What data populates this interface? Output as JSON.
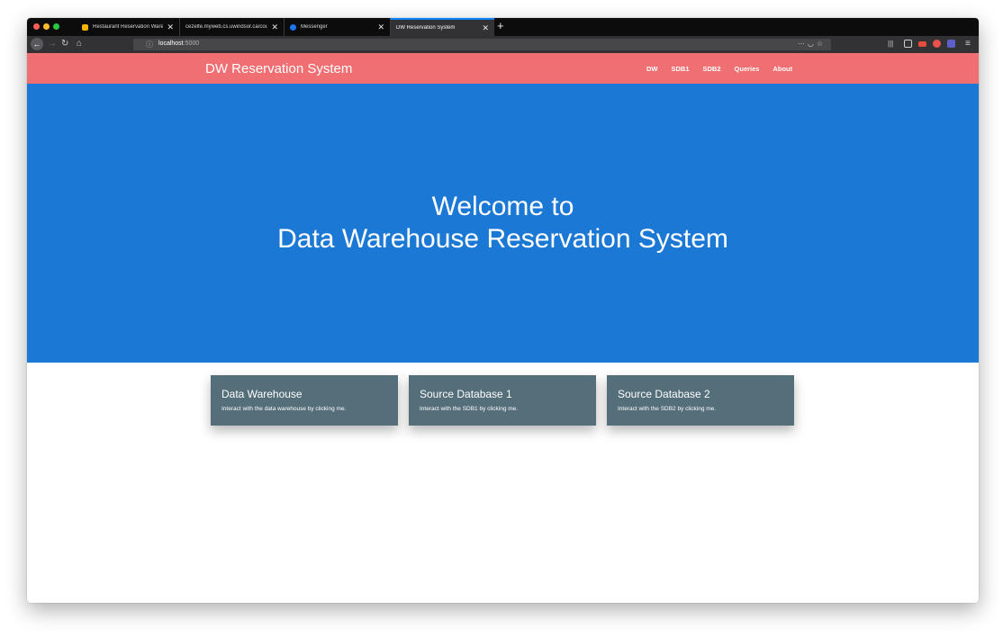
{
  "browser": {
    "tabs": [
      {
        "title": "Restaurant Reservation Wareh",
        "favicon_color": "#f4b400",
        "active": false
      },
      {
        "title": "cezelfe.myweb.cs.uwindsor.ca/cou",
        "favicon_color": "",
        "active": false
      },
      {
        "title": "Messenger",
        "favicon_color": "#1877f2",
        "active": false
      },
      {
        "title": "DW Reservation System",
        "favicon_color": "",
        "active": true
      }
    ],
    "close_glyph": "✕",
    "new_tab_glyph": "+",
    "url_host": "localhost",
    "url_port": ":5000",
    "nav_icons": [
      "back-icon",
      "forward-icon",
      "reload-icon",
      "home-icon"
    ],
    "url_right_icons": [
      "more-icon",
      "pocket-icon",
      "bookmark-star-icon"
    ],
    "toolbar_icons": [
      "library-icon",
      "sidebar-icon",
      "extension-red-icon",
      "extension-shield-icon",
      "extension-purple-icon",
      "menu-icon"
    ]
  },
  "site": {
    "brand": "DW Reservation System",
    "nav": [
      "DW",
      "SDB1",
      "SDB2",
      "Queries",
      "About"
    ],
    "hero": {
      "line1": "Welcome to",
      "line2": "Data Warehouse Reservation System"
    },
    "cards": [
      {
        "title": "Data Warehouse",
        "text": "Interact with the data warehouse by clicking me."
      },
      {
        "title": "Source Database 1",
        "text": "Interact with the SDB1 by clicking me."
      },
      {
        "title": "Source Database 2",
        "text": "Interact with the SDB2 by clicking me."
      }
    ],
    "colors": {
      "navbar": "#ef6f72",
      "hero": "#1b78d4",
      "card": "#546e7a"
    }
  }
}
